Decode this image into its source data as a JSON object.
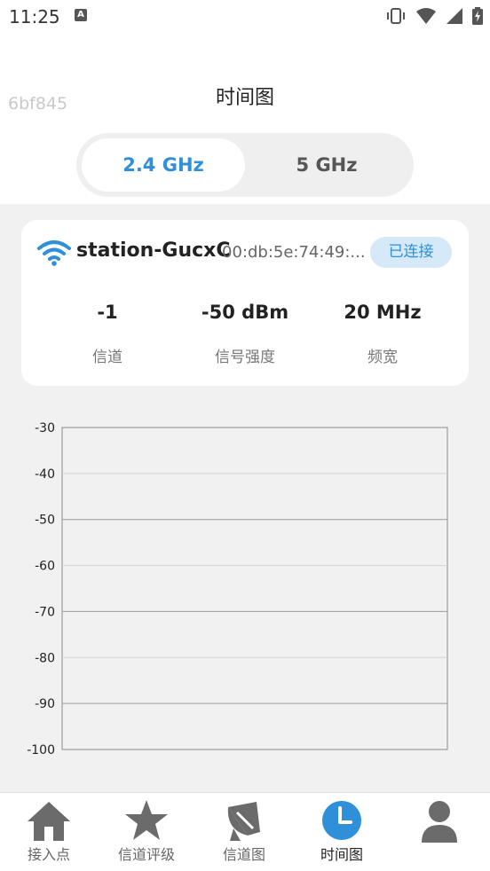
{
  "status_bar": {
    "time": "11:25",
    "notification_letter": "A",
    "icons": [
      "vibrate-icon",
      "wifi-signal-icon",
      "cell-signal-icon",
      "battery-charging-icon"
    ]
  },
  "header": {
    "hash": "6bf845",
    "title": "时间图"
  },
  "band_switch": {
    "options": [
      "2.4 GHz",
      "5 GHz"
    ],
    "selected": "2.4 GHz"
  },
  "station": {
    "ssid": "station-GucxC",
    "bssid": "00:db:5e:74:49:...",
    "status": "已连接",
    "stats": [
      {
        "value": "-1",
        "label": "信道"
      },
      {
        "value": "-50 dBm",
        "label": "信号强度"
      },
      {
        "value": "20 MHz",
        "label": "频宽"
      }
    ]
  },
  "chart_data": {
    "type": "line",
    "title": "",
    "xlabel": "",
    "ylabel": "",
    "ylim": [
      -100,
      -30
    ],
    "y_ticks": [
      "-30",
      "-40",
      "-50",
      "-60",
      "-70",
      "-80",
      "-90",
      "-100"
    ],
    "grid": true,
    "series": []
  },
  "bottom_nav": {
    "items": [
      {
        "label": "接入点",
        "icon": "home-icon",
        "active": false
      },
      {
        "label": "信道评级",
        "icon": "star-icon",
        "active": false
      },
      {
        "label": "信道图",
        "icon": "satellite-dish-icon",
        "active": false
      },
      {
        "label": "时间图",
        "icon": "clock-icon",
        "active": true
      },
      {
        "label": "",
        "icon": "person-icon",
        "active": false
      }
    ]
  },
  "colors": {
    "accent": "#2f8fd8",
    "badge_bg": "#d6e9f8",
    "content_bg": "#f1f1f1",
    "icon_gray": "#666666"
  }
}
